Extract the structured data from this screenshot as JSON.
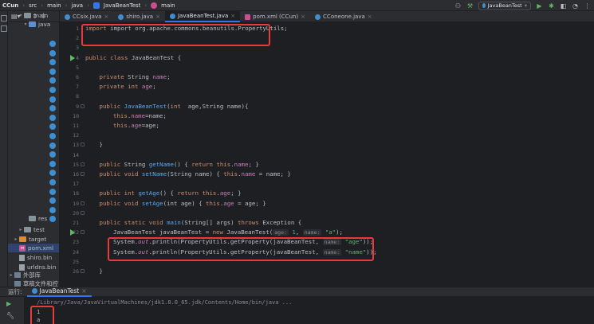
{
  "breadcrumb": [
    "CCun",
    "src",
    "main",
    "java",
    "JavaBeanTest",
    "main"
  ],
  "run_config": "JavaBeanTest",
  "project_tree": [
    {
      "label": "main",
      "kind": "folder",
      "indent": 2,
      "arrow": "v"
    },
    {
      "label": "java",
      "kind": "folder-blue",
      "indent": 3,
      "arrow": "v"
    },
    {
      "label": "res",
      "kind": "folder",
      "indent": 3,
      "arrow": ""
    },
    {
      "label": "test",
      "kind": "folder",
      "indent": 2,
      "arrow": ">"
    },
    {
      "label": "target",
      "kind": "folder-orange",
      "indent": 1,
      "arrow": ">"
    },
    {
      "label": "pom.xml",
      "kind": "maven",
      "indent": 1,
      "arrow": "",
      "selected": true
    },
    {
      "label": "shiro.bin",
      "kind": "file",
      "indent": 1,
      "arrow": ""
    },
    {
      "label": "urldns.bin",
      "kind": "file",
      "indent": 1,
      "arrow": ""
    },
    {
      "label": "外部库",
      "kind": "lib",
      "indent": 0,
      "arrow": ">"
    },
    {
      "label": "草稿文件和控",
      "kind": "lib",
      "indent": 0,
      "arrow": ""
    }
  ],
  "tabs": [
    {
      "label": "CCsix.java",
      "kind": "java",
      "active": false
    },
    {
      "label": "shiro.java",
      "kind": "java",
      "active": false
    },
    {
      "label": "JavaBeanTest.java",
      "kind": "java",
      "active": true
    },
    {
      "label": "pom.xml (CCun)",
      "kind": "maven",
      "active": false
    },
    {
      "label": "CConeone.java",
      "kind": "java",
      "active": false
    }
  ],
  "code": {
    "line_numbers": [
      "1",
      "2",
      "3",
      "4",
      "5",
      "6",
      "7",
      "8",
      "9",
      "10",
      "11",
      "12",
      "13",
      "14",
      "15",
      "16",
      "17",
      "18",
      "19",
      "20",
      "21",
      "22",
      "23",
      "24",
      "25",
      "26"
    ],
    "l1": "import org.apache.commons.beanutils.PropertyUtils;",
    "l4_kw": "public class",
    "l4_rest": " JavaBeanTest {",
    "private": "private",
    "string_type": " String ",
    "int_type": " int ",
    "name": "name",
    "age": "age",
    "semicolon": ";",
    "public": "public",
    "ctor_name": "JavaBeanTest",
    "ctor_params_a": "(",
    "int_kw": "int",
    "ctor_params_b": "  age,String name){",
    "this": "this",
    "dot": ".",
    "assign_name": "=name;",
    "assign_age": "=age;",
    "close_brace": "}",
    "getName": "getName",
    "setName": "setName",
    "getAge": "getAge",
    "setAge": "setAge",
    "string_ret": " String ",
    "void_kw": " void ",
    "int_ret": " int ",
    "l15_body": "() { ",
    "return_kw": "return",
    "l15_tail": "; }",
    "l16_params": "(String name) { ",
    "l16_tail": " = name; }",
    "l20_params": "(int age) { ",
    "l20_tail": " = age; }",
    "static_void": " static void ",
    "main": "main",
    "main_params": "(String[] args) ",
    "throws": "throws",
    "exception": " Exception {",
    "l22_a": "JavaBeanTest javaBeanTest = ",
    "new_kw": "new",
    "l22_b": " JavaBeanTest(",
    "hint_age": "age:",
    "num_1": " 1",
    "comma": ", ",
    "hint_name": "name:",
    "str_a": "\"a\"",
    "l22_end": ");",
    "system": "System.",
    "out": "out",
    "println": ".println(PropertyUtils.getProperty(javaBeanTest, ",
    "str_age": "\"age\"",
    "str_name": "\"name\"",
    "l23_end": "));",
    "l24_end": "));"
  },
  "run_panel": {
    "label": "运行:",
    "tab": "JavaBeanTest",
    "command": "/Library/Java/JavaVirtualMachines/jdk1.8.0_65.jdk/Contents/Home/bin/java ...",
    "output": [
      "1",
      "a"
    ]
  },
  "colors": {
    "highlight_box": "#e83a3a",
    "accent": "#3574f0",
    "run_green": "#5fb865"
  }
}
